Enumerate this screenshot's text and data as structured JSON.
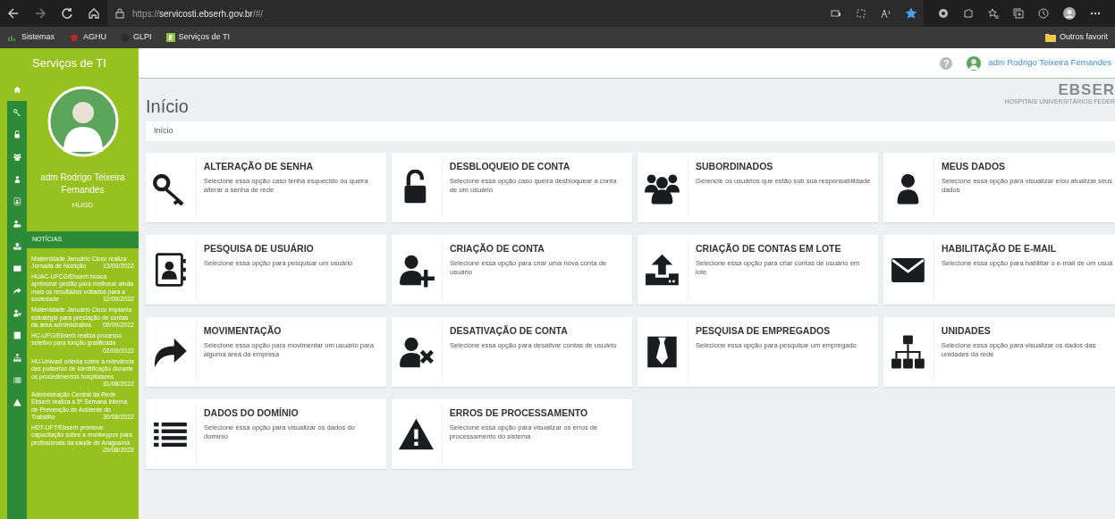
{
  "browser": {
    "url": "https://servicosti.ebserh.gov.br/#/",
    "bookmarks": [
      {
        "label": "Sistemas"
      },
      {
        "label": "AGHU"
      },
      {
        "label": "GLPI"
      },
      {
        "label": "Serviços de TI"
      }
    ],
    "other_bookmarks": "Outros favorit",
    "favorite": true
  },
  "app_title": "Serviços de TI",
  "header": {
    "help_glyph": "?",
    "user": "adm Rodrigo Teixeira Fernandes"
  },
  "profile": {
    "name": "adm Rodrigo Teixeira Fernandes",
    "unit": "HUGD"
  },
  "news": {
    "heading": "NOTÍCIAS",
    "items": [
      {
        "text": "Maternidade Januário Cicco realiza Jornada de Nutrição",
        "date": "13/09/2022"
      },
      {
        "text": "HUAC-UFCG/Ebserh busca aprimorar gestão para melhorar ainda mais os resultados voltados para a sociedade",
        "date": "12/09/2022"
      },
      {
        "text": "Maternidade Januário Cicco implanta estratégia para prestação de contas da área administrativa",
        "date": "05/09/2022"
      },
      {
        "text": "HC-UFG/Ebserh realiza processo seletivo para função gratificada",
        "date": "02/09/2022"
      },
      {
        "text": "HU-Univasf orienta sobre a relevância das pulseiras de identificação durante os procedimentos hospitalares",
        "date": "31/08/2022"
      },
      {
        "text": "Administração Central da Rede Ebserh realiza a 5ª Semana Interna de Prevenção de Acidente do Trabalho",
        "date": "30/08/2022"
      },
      {
        "text": "HDT-UFT/Ebserh promove capacitação sobre a monkeypox para profissionais da saúde de Araguaína",
        "date": "29/08/2022"
      }
    ]
  },
  "page_title": "Início",
  "logo": {
    "name": "EBSER",
    "tagline": "HOSPITAIS UNIVERSITÁRIOS FEDER"
  },
  "breadcrumb": [
    "Início"
  ],
  "cards": [
    {
      "title": "ALTERAÇÃO DE SENHA",
      "description": "Selecione essa opção caso tenha esquecido ou queira alterar a senha de rede"
    },
    {
      "title": "DESBLOQUEIO DE CONTA",
      "description": "Selecione essa opção caso queira desbloquear a conta de um usuário"
    },
    {
      "title": "SUBORDINADOS",
      "description": "Gerencie os usuários que estão sob sua responsabilidade"
    },
    {
      "title": "MEUS DADOS",
      "description": "Selecione essa opção para visualizar e/ou atualizar seus dados"
    },
    {
      "title": "PESQUISA DE USUÁRIO",
      "description": "Selecione essa opção para pesquisar um usuário"
    },
    {
      "title": "CRIAÇÃO DE CONTA",
      "description": "Selecione essa opção para criar uma nova conta de usuário"
    },
    {
      "title": "CRIAÇÃO DE CONTAS EM LOTE",
      "description": "Selecione essa opção para criar contas de usuário em lote"
    },
    {
      "title": "HABILITAÇÃO DE E-MAIL",
      "description": "Selecione essa opção para habilitar o e-mail de um usuá"
    },
    {
      "title": "MOVIMENTAÇÃO",
      "description": "Selecione essa opção para movimentar um usuário para alguma área da empresa"
    },
    {
      "title": "DESATIVAÇÃO DE CONTA",
      "description": "Selecione essa opção para desativar contas de usuário"
    },
    {
      "title": "PESQUISA DE EMPREGADOS",
      "description": "Selecione essa opção para pesquisar um empregado"
    },
    {
      "title": "UNIDADES",
      "description": "Selecione essa opção para visualizar os dados das unidades da rede"
    },
    {
      "title": "DADOS DO DOMÍNIO",
      "description": "Selecione essa opção para visualizar os dados do domínio"
    },
    {
      "title": "ERROS DE PROCESSAMENTO",
      "description": "Selecione essa opção para visualizar os erros de processamento do sistema"
    }
  ]
}
